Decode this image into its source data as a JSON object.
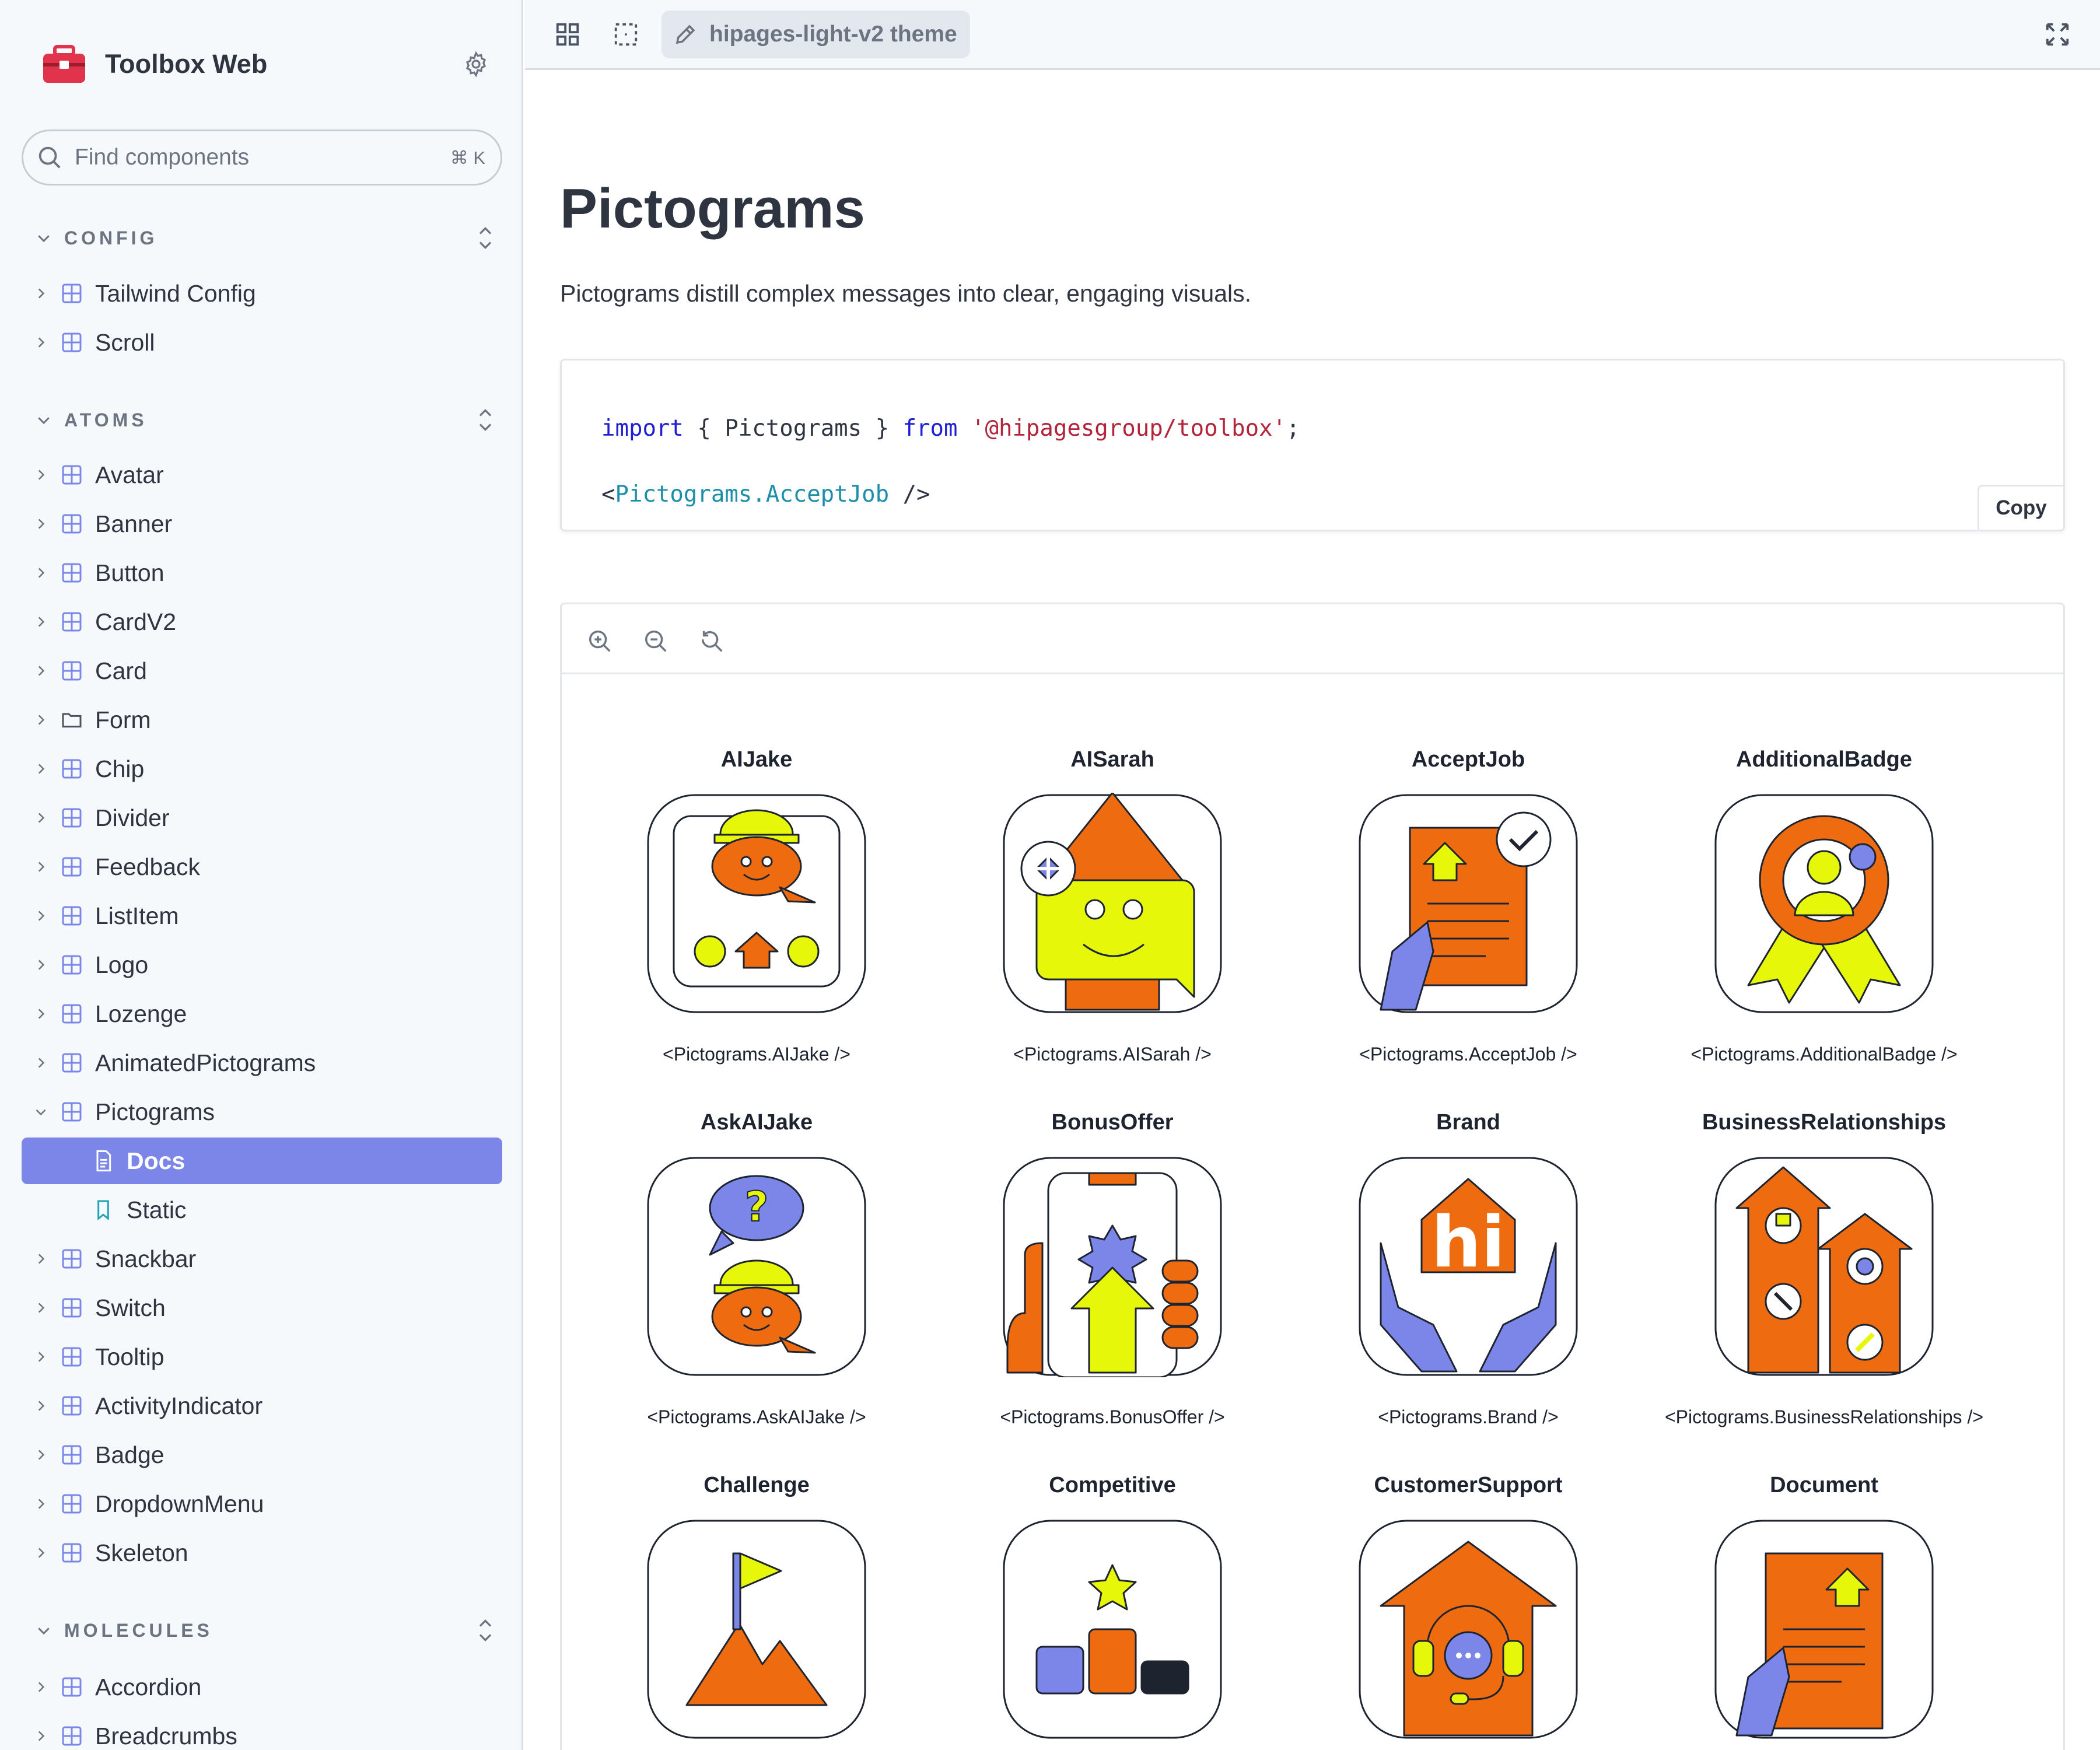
{
  "app": {
    "title": "Toolbox Web"
  },
  "search": {
    "placeholder": "Find components",
    "shortcut": "⌘ K"
  },
  "sidebar": {
    "sections": [
      {
        "label": "CONFIG",
        "items": [
          "Tailwind Config",
          "Scroll"
        ]
      },
      {
        "label": "ATOMS",
        "items": [
          "Avatar",
          "Banner",
          "Button",
          "CardV2",
          "Card",
          "Form",
          "Chip",
          "Divider",
          "Feedback",
          "ListItem",
          "Logo",
          "Lozenge",
          "AnimatedPictograms",
          "Pictograms",
          "Docs",
          "Static",
          "Snackbar",
          "Switch",
          "Tooltip",
          "ActivityIndicator",
          "Badge",
          "DropdownMenu",
          "Skeleton"
        ]
      },
      {
        "label": "MOLECULES",
        "items": [
          "Accordion",
          "Breadcrumbs"
        ]
      }
    ],
    "active_item": "Docs"
  },
  "toolbar": {
    "theme_label": "hipages-light-v2 theme"
  },
  "page": {
    "title": "Pictograms",
    "description": "Pictograms distill complex messages into clear, engaging visuals."
  },
  "code": {
    "line1": {
      "kw_import": "import",
      "mid": " { Pictograms } ",
      "kw_from": "from",
      "space": " ",
      "str": "'@hipagesgroup/toolbox'",
      "end": ";"
    },
    "line2": {
      "open": "<",
      "tag": "Pictograms.AcceptJob",
      "close": " />"
    },
    "copy_label": "Copy"
  },
  "pictograms": [
    {
      "name": "AIJake",
      "code": "<Pictograms.AIJake />"
    },
    {
      "name": "AISarah",
      "code": "<Pictograms.AISarah />"
    },
    {
      "name": "AcceptJob",
      "code": "<Pictograms.AcceptJob />"
    },
    {
      "name": "AdditionalBadge",
      "code": "<Pictograms.AdditionalBadge />"
    },
    {
      "name": "AskAIJake",
      "code": "<Pictograms.AskAIJake />"
    },
    {
      "name": "BonusOffer",
      "code": "<Pictograms.BonusOffer />"
    },
    {
      "name": "Brand",
      "code": "<Pictograms.Brand />"
    },
    {
      "name": "BusinessRelationships",
      "code": "<Pictograms.BusinessRelationships />"
    },
    {
      "name": "Challenge",
      "code": ""
    },
    {
      "name": "Competitive",
      "code": ""
    },
    {
      "name": "CustomerSupport",
      "code": ""
    },
    {
      "name": "Document",
      "code": ""
    }
  ],
  "colors": {
    "orange": "#ee6b10",
    "lime": "#e6f70a",
    "purple": "#7b86e8",
    "navy": "#1d2430",
    "accent": "#7b86e8"
  }
}
